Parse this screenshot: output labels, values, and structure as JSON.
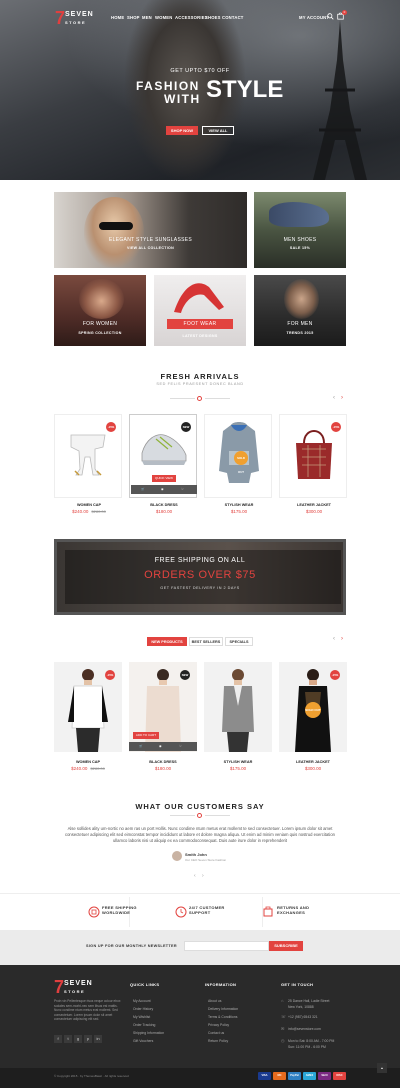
{
  "brand": {
    "name": "SEVEN",
    "tagline": "STORE",
    "mark": "7"
  },
  "nav": {
    "items": [
      "HOME",
      "SHOP",
      "MEN",
      "WOMEN",
      "ACCESSORIES",
      "SHOES",
      "CONTACT"
    ],
    "account": "MY ACCOUNT",
    "cart_count": "0"
  },
  "hero": {
    "subtitle": "GET UPTO $70 OFF",
    "title_line1": "FASHION",
    "title_line2": "WITH",
    "title_emphasis": "STYLE",
    "cta_primary": "SHOP NOW",
    "cta_secondary": "VIEW ALL"
  },
  "banners": [
    {
      "title": "ELEGANT STYLE SUNGLASSES",
      "subtitle": "VIEW ALL COLLECTION"
    },
    {
      "title": "MEN SHOES",
      "subtitle": "SALE 15%"
    },
    {
      "title": "FOR WOMEN",
      "subtitle": "SPRING COLLECTION"
    },
    {
      "title": "FOOT WEAR",
      "subtitle": "LATEST DESIGNS"
    },
    {
      "title": "FOR MEN",
      "subtitle": "TRENDS 2015"
    }
  ],
  "fresh_arrivals": {
    "title": "FRESH ARRIVALS",
    "subtitle": "SED FELIS PRAESENT DONEC BLAND",
    "products": [
      {
        "name": "WOMEN CAP",
        "price": "$240.00",
        "old_price": "$280.00",
        "badge": "-15%"
      },
      {
        "name": "BLACK DRESS",
        "price": "$180.00",
        "badge": "NEW",
        "action": "QUICK VIEW"
      },
      {
        "name": "STYLISH WEAR",
        "price": "$175.00",
        "label": "SOLD OUT"
      },
      {
        "name": "LEATHER JACKET",
        "price": "$300.00",
        "badge": "-15%"
      }
    ]
  },
  "promo": {
    "line1": "FREE SHIPPING ON ALL",
    "line2": "ORDERS OVER $75",
    "line3": "GET FASTEST DELIVERY IN 2 DAYS"
  },
  "tabs": [
    "NEW PRODUCTS",
    "BEST SELLERS",
    "SPECIALS"
  ],
  "new_products": [
    {
      "name": "WOMEN CAP",
      "price": "$240.00",
      "old_price": "$280.00",
      "badge": "-15%"
    },
    {
      "name": "BLACK DRESS",
      "price": "$180.00",
      "badge": "NEW",
      "action": "ADD TO CART"
    },
    {
      "name": "STYLISH WEAR",
      "price": "$175.00"
    },
    {
      "name": "LEATHER JACKET",
      "price": "$300.00",
      "badge": "-15%",
      "label": "SOLD OUT"
    }
  ],
  "testimonials": {
    "title": "WHAT OUR CUSTOMERS SAY",
    "quote": "Alse sollides ality um-nortic no aem ras un port Hollis. Nunc condime ntum metus erat mollemt te sed consectetuer. Lorem ipsum dolor sit amet consectetuer adipiscing elit sed eimconstat tempor incididunt ut labore et dolore magna aliqua. Ut enim ad minim veniam quis nostrud exercitation ullamco laboris nisi ut aliquip ex ea commodoconsequat. Duis aute irure dolor in reprehenderit",
    "author": "Smith John",
    "author_role": "Our CEO Seven Store Fashion"
  },
  "features": [
    {
      "line1": "FREE SHIPPING",
      "line2": "WORLDWIDE"
    },
    {
      "line1": "24/7 CUSTOMER",
      "line2": "SUPPORT"
    },
    {
      "line1": "RETURNS AND",
      "line2": "EXCHANGES"
    }
  ],
  "newsletter": {
    "label": "SIGN UP FOR OUR MONTHLY NEWSLETTER",
    "placeholder": "",
    "button": "SUBSCRIBE"
  },
  "footer": {
    "about": "Proin vin Pellentesque risus neque colour ebox sodales sem-morbi-nec sem litsus est mattis. Nunc condime ntum metus erat mollemt. Sed consectetuer. Lorem ipsum dolor sit amet consectetuer adipiscing elit sed.",
    "quick_links_title": "QUICK LINKS",
    "quick_links": [
      "My Account",
      "Order History",
      "My Wishlist",
      "Order Tracking",
      "Shipping Information",
      "Gift Vouchers"
    ],
    "information_title": "INFORMATION",
    "information": [
      "About us",
      "Delivery Information",
      "Terms & Conditions",
      "Privacy Policy",
      "Contact us",
      "Return Policy"
    ],
    "contact_title": "GET IN TOUCH",
    "contact": [
      "25 Dance Hall, Ladie Street",
      "New York, 10888",
      "+12 (987) 6543 321",
      "info@sevenstore.com",
      "Mon to Sat: 8:00 AM - 7:00 PM",
      "Sun: 11:00 PM - 6:00 PM"
    ],
    "copyright": "© Copyright 2015 · by ThemesBasic · All rights reserved",
    "payments": [
      "VISA",
      "MC",
      "PayPal",
      "AMEX",
      "Skrill",
      "DISC"
    ]
  }
}
